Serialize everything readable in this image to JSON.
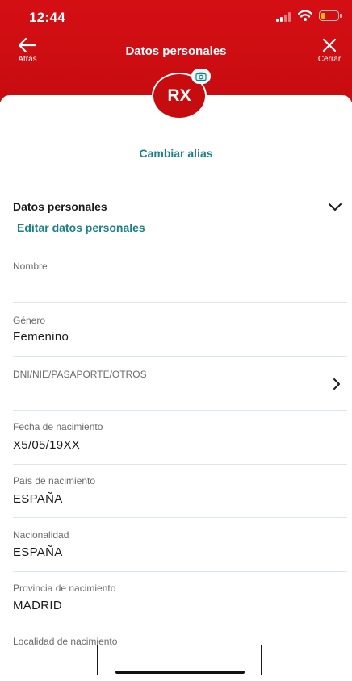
{
  "status_bar": {
    "time": "12:44",
    "battery_level": 0.25,
    "battery_color": "#f2c200"
  },
  "header": {
    "title": "Datos personales",
    "back_label": "Atrás",
    "close_label": "Cerrar",
    "background_color": "#d40f14",
    "back_icon": "arrow-left-icon",
    "close_icon": "close-icon"
  },
  "profile": {
    "initials": "RX",
    "camera_icon": "camera-icon",
    "change_alias_label": "Cambiar alias",
    "accent_color": "#1a7f86"
  },
  "section": {
    "title": "Datos personales",
    "edit_label": "Editar datos personales",
    "chevron_icon": "chevron-down-icon"
  },
  "fields": [
    {
      "label": "Nombre",
      "value": ""
    },
    {
      "label": "Género",
      "value": "Femenino"
    },
    {
      "label": "DNI/NIE/PASAPORTE/OTROS",
      "value": ""
    },
    {
      "label": "Fecha de nacimiento",
      "value": "X5/05/19XX"
    },
    {
      "label": "País de nacimiento",
      "value": "ESPAÑA"
    },
    {
      "label": "Nacionalidad",
      "value": "ESPAÑA"
    },
    {
      "label": "Provincia de nacimiento",
      "value": "MADRID"
    },
    {
      "label": "Localidad de nacimiento",
      "value": ""
    }
  ]
}
